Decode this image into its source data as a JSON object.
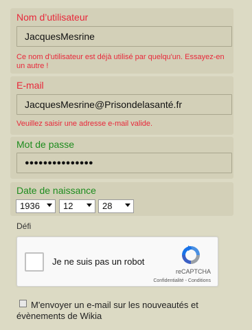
{
  "username": {
    "label": "Nom d’utilisateur",
    "value": "JacquesMesrine",
    "error": "Ce nom d'utilisateur est déjà utilisé par quelqu'un. Essayez-en un autre !",
    "label_color": "#e8283a"
  },
  "email": {
    "label": "E-mail",
    "value": "JacquesMesrine@Prisondelasanté.fr",
    "error": "Veuillez saisir une adresse e-mail valide.",
    "label_color": "#e8283a"
  },
  "password": {
    "label": "Mot de passe",
    "value": "●●●●●●●●●●●●●●●",
    "label_color": "#1e8c1e"
  },
  "birthdate": {
    "label": "Date de naissance",
    "year": "1936",
    "month": "12",
    "day": "28",
    "label_color": "#1e8c1e"
  },
  "challenge": {
    "label": "Défi",
    "recaptcha_text": "Je ne suis pas un robot",
    "brand": "reCAPTCHA",
    "links": "Confidentialité - Conditions",
    "icon": "recaptcha-logo-icon"
  },
  "newsletter": {
    "label": "M'envoyer un e-mail sur les nouveautés et évènements de Wikia",
    "checked": false
  }
}
